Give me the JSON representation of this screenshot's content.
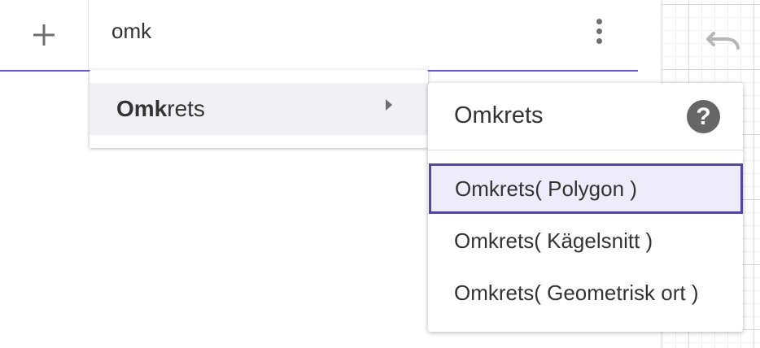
{
  "input": {
    "value": "omk",
    "add_icon": "plus-icon",
    "more_icon": "more-vertical-icon"
  },
  "suggestions": [
    {
      "match": "Omk",
      "rest": "rets",
      "submenu_icon": "chevron-right-icon"
    }
  ],
  "syntax_menu": {
    "title": "Omkrets",
    "help_icon": "help-icon",
    "help_glyph": "?",
    "items": [
      {
        "label": "Omkrets( Polygon )",
        "selected": true
      },
      {
        "label": "Omkrets( Kägelsnitt )",
        "selected": false
      },
      {
        "label": "Omkrets( Geometrisk ort )",
        "selected": false
      }
    ]
  },
  "graphics": {
    "undo_icon": "undo-icon"
  },
  "colors": {
    "accent": "#6557d2",
    "selected_border": "#52489f",
    "selected_bg": "#eeecfa",
    "hover_bg": "#f1f1f5",
    "icon_gray": "#6e6e6e"
  }
}
